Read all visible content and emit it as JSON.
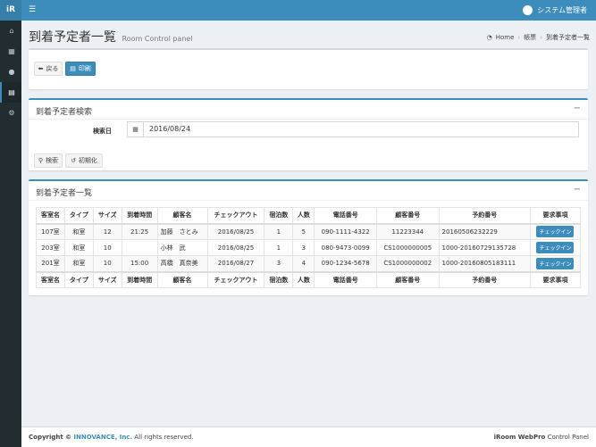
{
  "app": {
    "logo": "iR",
    "user_name": "システム管理者"
  },
  "sidebar": {
    "icons": [
      "home-icon",
      "calendar-icon",
      "user-icon",
      "print-icon",
      "gears-icon"
    ]
  },
  "header": {
    "title": "到着予定者一覧",
    "subtitle": "Room Control panel",
    "breadcrumb": [
      "Home",
      "帳票",
      "到着予定者一覧"
    ]
  },
  "toolbar": {
    "back_label": "戻る",
    "print_label": "印刷"
  },
  "search": {
    "title": "到着予定者検索",
    "date_label": "検索日",
    "date_value": "2016/08/24",
    "search_label": "検索",
    "reset_label": "初期化"
  },
  "list": {
    "title": "到着予定者一覧",
    "columns": [
      "客室名",
      "タイプ",
      "サイズ",
      "到着時間",
      "顧客名",
      "チェックアウト",
      "宿泊数",
      "人数",
      "電話番号",
      "顧客番号",
      "予約番号",
      "要求事項"
    ],
    "rows": [
      [
        "107室",
        "和室",
        "12",
        "21:25",
        "加藤　さとみ",
        "2016/08/25",
        "1",
        "5",
        "090-1111-4322",
        "11223344",
        "20160506232229",
        "チェックイン"
      ],
      [
        "203室",
        "和室",
        "10",
        "",
        "小林　武",
        "2016/08/25",
        "1",
        "3",
        "080-9473-0099",
        "CS1000000005",
        "1000-20160729135728",
        "チェックイン"
      ],
      [
        "201室",
        "和室",
        "10",
        "15:00",
        "高橋　真奈美",
        "2016/08/27",
        "3",
        "4",
        "090-1234-5678",
        "CS1000000002",
        "1000-20160805183111",
        "チェックイン"
      ]
    ]
  },
  "footer": {
    "copyright_prefix": "Copyright ©",
    "company": "INNOVANCE, Inc.",
    "rights": "All rights reserved.",
    "product": "iRoom WebPro",
    "product_suffix": "Control Panel"
  },
  "colors": {
    "primary": "#3c8dbc",
    "sidebar": "#222d32",
    "background": "#ecf0f5"
  }
}
